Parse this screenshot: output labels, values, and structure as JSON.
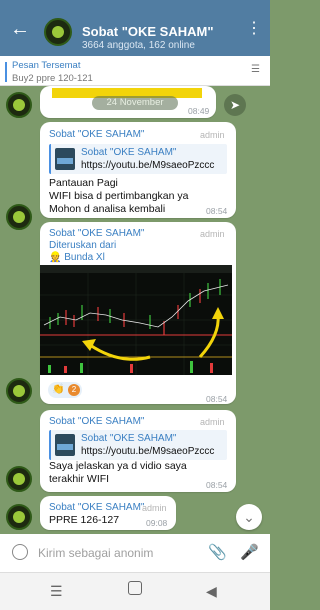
{
  "header": {
    "back_icon": "arrow-left-icon",
    "title": "Sobat \"OKE SAHAM\"",
    "subtitle": "3664 anggota, 162 online",
    "menu_icon": "more-vertical-icon"
  },
  "pinned": {
    "title": "Pesan Tersemat",
    "preview": "Buy2 ppre 120-121",
    "icon": "pin-list-icon"
  },
  "date_chip": "24 November",
  "top_message": {
    "time": "08:49"
  },
  "messages": [
    {
      "sender": "Sobat \"OKE SAHAM\"",
      "role": "admin",
      "link_name": "Sobat \"OKE SAHAM\"",
      "link_url": "https://youtu.be/M9saeoPzccc",
      "lines": [
        "Pantauan Pagi",
        "WIFI bisa d pertimbangkan ya",
        "Mohon d analisa kembali"
      ],
      "time": "08:54"
    },
    {
      "sender": "Sobat \"OKE SAHAM\"",
      "role": "admin",
      "forwarded_label": "Diteruskan dari",
      "forwarded_from": "Bunda Xl",
      "time": "08:54",
      "reaction_count": "2"
    },
    {
      "sender": "Sobat \"OKE SAHAM\"",
      "role": "admin",
      "link_name": "Sobat \"OKE SAHAM\"",
      "link_url": "https://youtu.be/M9saeoPzccc",
      "lines": [
        "Saya jelaskan ya d vidio saya",
        "terakhir WIFI"
      ],
      "time": "08:54"
    },
    {
      "sender": "Sobat \"OKE SAHAM\"",
      "role": "admin",
      "lines": [
        "PPRE 126-127"
      ],
      "time": "09:08"
    }
  ],
  "input": {
    "placeholder": "Kirim sebagai anonim",
    "emoji_icon": "emoji-icon",
    "attach_icon": "attach-icon",
    "mic_icon": "mic-icon"
  },
  "nav": {
    "recents_icon": "recents-icon",
    "home_icon": "home-icon",
    "back_icon": "nav-back-icon"
  },
  "colors": {
    "header": "#517da2",
    "chat_bg": "#7d9a6b",
    "accent": "#3a7fc2",
    "yellow": "#f2d40a"
  }
}
